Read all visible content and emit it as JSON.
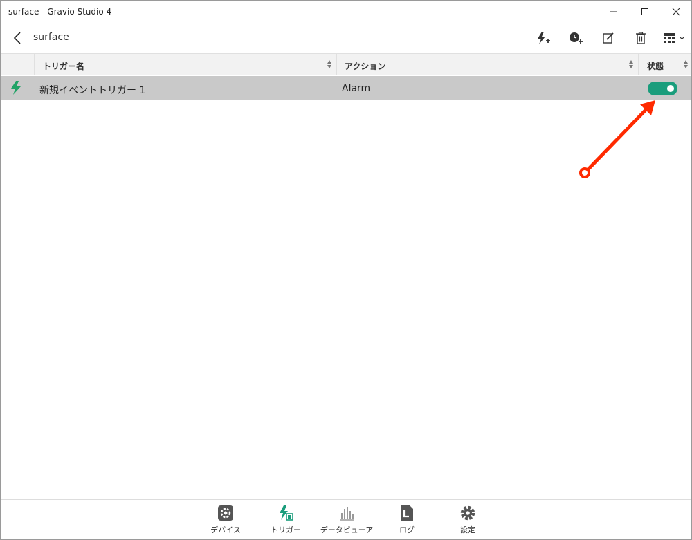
{
  "window": {
    "title": "surface - Gravio Studio 4"
  },
  "header": {
    "device_name": "surface"
  },
  "table": {
    "columns": [
      {
        "label": "トリガー名"
      },
      {
        "label": "アクション"
      },
      {
        "label": "状態"
      }
    ],
    "rows": [
      {
        "name": "新規イベントトリガー 1",
        "action": "Alarm",
        "enabled": true
      }
    ]
  },
  "bottom_nav": {
    "items": [
      {
        "label": "デバイス",
        "icon": "gear-box-icon"
      },
      {
        "label": "トリガー",
        "icon": "trigger-icon",
        "active": true
      },
      {
        "label": "データビューア",
        "icon": "bar-chart-icon"
      },
      {
        "label": "ログ",
        "icon": "log-icon"
      },
      {
        "label": "設定",
        "icon": "settings-icon"
      }
    ]
  },
  "colors": {
    "accent": "#1a9d7c",
    "trigger_green": "#21a366",
    "annotation": "#ff2a00",
    "row_selected": "#c9c9c9"
  }
}
